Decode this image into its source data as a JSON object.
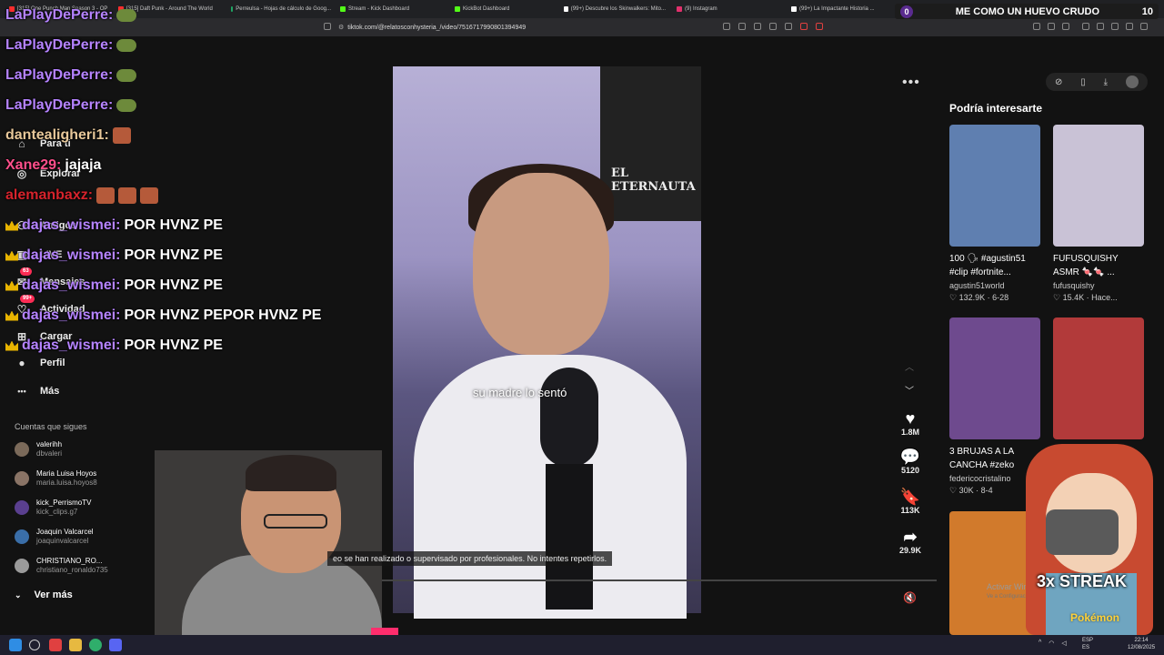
{
  "browser": {
    "tabs": [
      {
        "label": "[315] One Punch Man Season 3 - OP",
        "color": "#ff2d2d"
      },
      {
        "label": "[315] Daft Punk - Around The World",
        "color": "#ff2d2d"
      },
      {
        "label": "Perreulsa - Hojas de cálculo de Goog...",
        "color": "#1fa463"
      },
      {
        "label": "Stream - Kick Dashboard",
        "color": "#53fc18"
      },
      {
        "label": "KickBot Dashboard",
        "color": "#53fc18"
      },
      {
        "label": "(99+) Descubre los Skinwalkers: Mito...",
        "color": "#ffffff"
      },
      {
        "label": "(9) Instagram",
        "color": "#e1306c"
      },
      {
        "label": "(99+) La Impactante Historia ...",
        "color": "#ffffff"
      }
    ],
    "url": "tiktok.com/@relatosconhysteria_/video/7516717990801394949"
  },
  "scoreboard": {
    "left": "0",
    "title": "ME COMO UN HUEVO CRUDO",
    "right": "10"
  },
  "sidebar": {
    "nav": [
      {
        "label": "Para ti",
        "icon": "home-icon"
      },
      {
        "label": "Explorar",
        "icon": "compass-icon"
      },
      {
        "label": "Amigos",
        "icon": "friends-icon"
      },
      {
        "label": "LIVE",
        "icon": "live-icon"
      },
      {
        "label": "Mensajes",
        "icon": "message-icon",
        "badge": "63"
      },
      {
        "label": "Actividad",
        "icon": "activity-icon",
        "badge": "99+"
      },
      {
        "label": "Cargar",
        "icon": "upload-icon"
      },
      {
        "label": "Perfil",
        "icon": "profile-icon"
      },
      {
        "label": "Más",
        "icon": "more-icon"
      }
    ],
    "following_title": "Cuentas que sigues",
    "following": [
      {
        "name": "valerihh",
        "user": "dbvaleri"
      },
      {
        "name": "Maria Luisa Hoyos",
        "user": "maria.luisa.hoyos8"
      },
      {
        "name": "kick_PerrismoTV",
        "user": "kick_clips.g7"
      },
      {
        "name": "Joaquin Valcarcel",
        "user": "joaquinvalcarcel"
      },
      {
        "name": "CHRISTIANO_RO...",
        "user": "christiano_ronaldo735"
      }
    ],
    "see_more": "Ver más"
  },
  "chat": [
    {
      "user": "LaPlayDePerre:",
      "msg": "",
      "color": "#b583ff",
      "emote": "pepe"
    },
    {
      "user": "LaPlayDePerre:",
      "msg": "",
      "color": "#b583ff",
      "emote": "pepe"
    },
    {
      "user": "LaPlayDePerre:",
      "msg": "",
      "color": "#b583ff",
      "emote": "pepe"
    },
    {
      "user": "LaPlayDePerre:",
      "msg": "",
      "color": "#b583ff",
      "emote": "pepe"
    },
    {
      "user": "dantealigheri1:",
      "msg": "",
      "color": "#e8c89a",
      "emote": "face"
    },
    {
      "user": "Xane29:",
      "msg": "jajaja",
      "color": "#ff4f8b",
      "emote": ""
    },
    {
      "user": "alemanbaxz:",
      "msg": "",
      "color": "#d6232c",
      "emote": "triple"
    },
    {
      "user": "dajas_wismei:",
      "msg": "POR HVNZ PE",
      "color": "#b583ff",
      "emote": "crown"
    },
    {
      "user": "dajas_wismei:",
      "msg": "POR HVNZ PE",
      "color": "#b583ff",
      "emote": "crown"
    },
    {
      "user": "dajas_wismei:",
      "msg": "POR HVNZ PE",
      "color": "#b583ff",
      "emote": "crown"
    },
    {
      "user": "dajas_wismei:",
      "msg": "POR HVNZ PEPOR HVNZ PE",
      "color": "#b583ff",
      "emote": "crown"
    },
    {
      "user": "dajas_wismei:",
      "msg": "POR HVNZ PE",
      "color": "#b583ff",
      "emote": "crown"
    }
  ],
  "video": {
    "poster_text": "EL ETERNAUTA",
    "caption": "su madre lo sentó",
    "disclaimer": "eo se han realizado o supervisado por profesionales. No intentes repetirlos."
  },
  "actions": {
    "likes": "1.8M",
    "comments": "5120",
    "saves": "113K",
    "shares": "29.9K"
  },
  "recommend": {
    "title": "Podría interesarte",
    "items": [
      {
        "title": "100 🗣 #agustin51 #clip #fortnite...",
        "author": "agustin51world",
        "likes": "132.9K",
        "date": "6-28",
        "bg": "#5f7fb0"
      },
      {
        "title": "FUFUSQUISHY ASMR 🍬🍬 ...",
        "author": "fufusquishy",
        "likes": "15.4K",
        "date": "Hace...",
        "bg": "#c9c2d6"
      },
      {
        "title": "3 BRUJAS A LA CANCHA #zeko",
        "author": "federicocristalino",
        "likes": "30K",
        "date": "8-4",
        "bg": "#6e4a8e"
      },
      {
        "title": "",
        "author": "",
        "likes": "",
        "date": "",
        "bg": "#b23a3a"
      },
      {
        "title": "",
        "author": "",
        "likes": "",
        "date": "",
        "bg": "#d17a2c"
      }
    ]
  },
  "overlay": {
    "streak": "3x STREAK",
    "pokemon": "Pokémon",
    "win_title": "Activar Windows",
    "win_sub": "Ve a Configuración para activar Windows."
  },
  "taskbar": {
    "lang1": "ESP",
    "lang2": "ES",
    "time": "22:14",
    "date": "12/08/2025"
  }
}
